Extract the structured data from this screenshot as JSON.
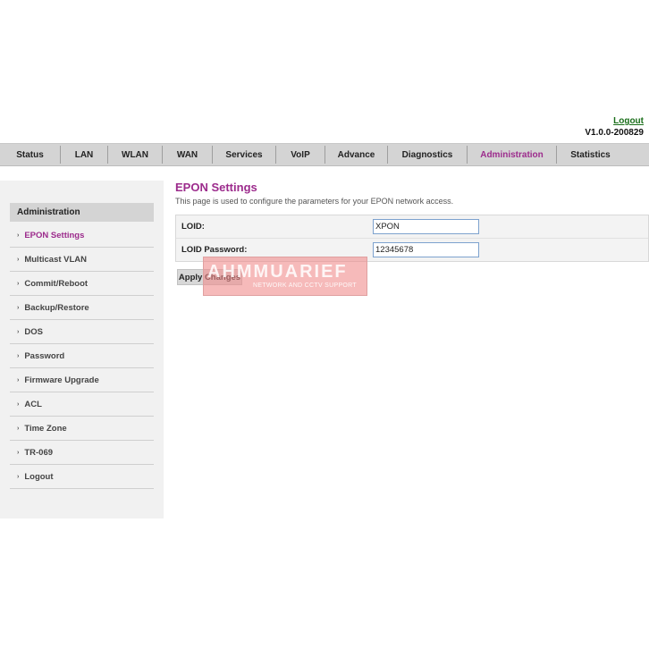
{
  "header": {
    "logout_link": "Logout",
    "version": "V1.0.0-200829"
  },
  "nav": {
    "items": [
      {
        "label": "Status"
      },
      {
        "label": "LAN"
      },
      {
        "label": "WLAN"
      },
      {
        "label": "WAN"
      },
      {
        "label": "Services"
      },
      {
        "label": "VoIP"
      },
      {
        "label": "Advance"
      },
      {
        "label": "Diagnostics"
      },
      {
        "label": "Administration",
        "active": true
      },
      {
        "label": "Statistics"
      }
    ],
    "active_color": "#9c2b8c"
  },
  "sidebar": {
    "title": "Administration",
    "items": [
      {
        "label": "EPON Settings",
        "active": true
      },
      {
        "label": "Multicast VLAN"
      },
      {
        "label": "Commit/Reboot"
      },
      {
        "label": "Backup/Restore"
      },
      {
        "label": "DOS"
      },
      {
        "label": "Password"
      },
      {
        "label": "Firmware Upgrade"
      },
      {
        "label": "ACL"
      },
      {
        "label": "Time Zone"
      },
      {
        "label": "TR-069"
      },
      {
        "label": "Logout"
      }
    ]
  },
  "main": {
    "title": "EPON Settings",
    "description": "This page is used to configure the parameters for your EPON network access.",
    "fields": [
      {
        "label": "LOID:",
        "value": "XPON"
      },
      {
        "label": "LOID Password:",
        "value": "12345678"
      }
    ],
    "apply_label": "Apply Changes"
  },
  "watermark": {
    "text": "AHMMUARIEF",
    "subtext": "NETWORK AND CCTV SUPPORT"
  }
}
